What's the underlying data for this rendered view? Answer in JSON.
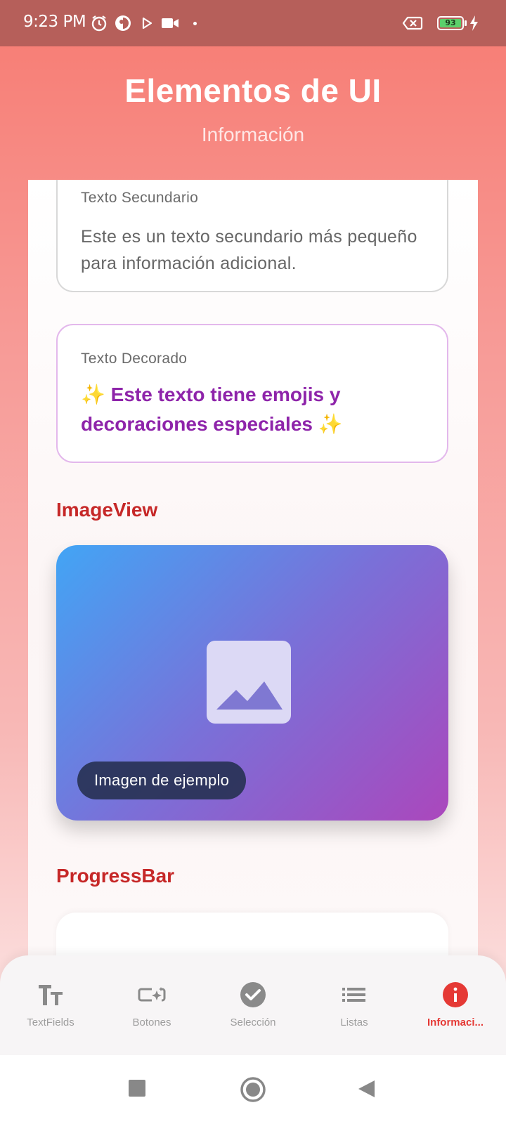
{
  "status_bar": {
    "time": "9:23 PM",
    "battery": "93",
    "icons": [
      "alarm-icon",
      "app-icon",
      "play-store-icon",
      "video-icon",
      "dot-icon",
      "battery-x-icon",
      "battery-icon",
      "charging-icon"
    ]
  },
  "header": {
    "title": "Elementos de UI",
    "subtitle": "Información"
  },
  "cards": {
    "secondary": {
      "label": "Texto Secundario",
      "text": "Este es un texto secundario más pequeño para información adicional."
    },
    "decorated": {
      "label": "Texto Decorado",
      "text": "✨ Este texto tiene emojis y decoraciones especiales ✨"
    }
  },
  "sections": {
    "image_view": "ImageView",
    "progress_bar": "ProgressBar"
  },
  "image_card": {
    "caption": "Imagen de ejemplo",
    "icon": "image-icon",
    "gradient": [
      "#42a5f5",
      "#ab47bc"
    ]
  },
  "bottom_nav": {
    "items": [
      {
        "label": "TextFields",
        "icon": "text-format-icon"
      },
      {
        "label": "Botones",
        "icon": "smart-button-icon"
      },
      {
        "label": "Selección",
        "icon": "check-circle-icon"
      },
      {
        "label": "Listas",
        "icon": "list-icon"
      },
      {
        "label": "Informaci...",
        "icon": "info-icon"
      }
    ],
    "active_index": 4
  },
  "colors": {
    "accent": "#c62828",
    "active_nav": "#e53935",
    "decorated_text": "#8e24aa"
  }
}
